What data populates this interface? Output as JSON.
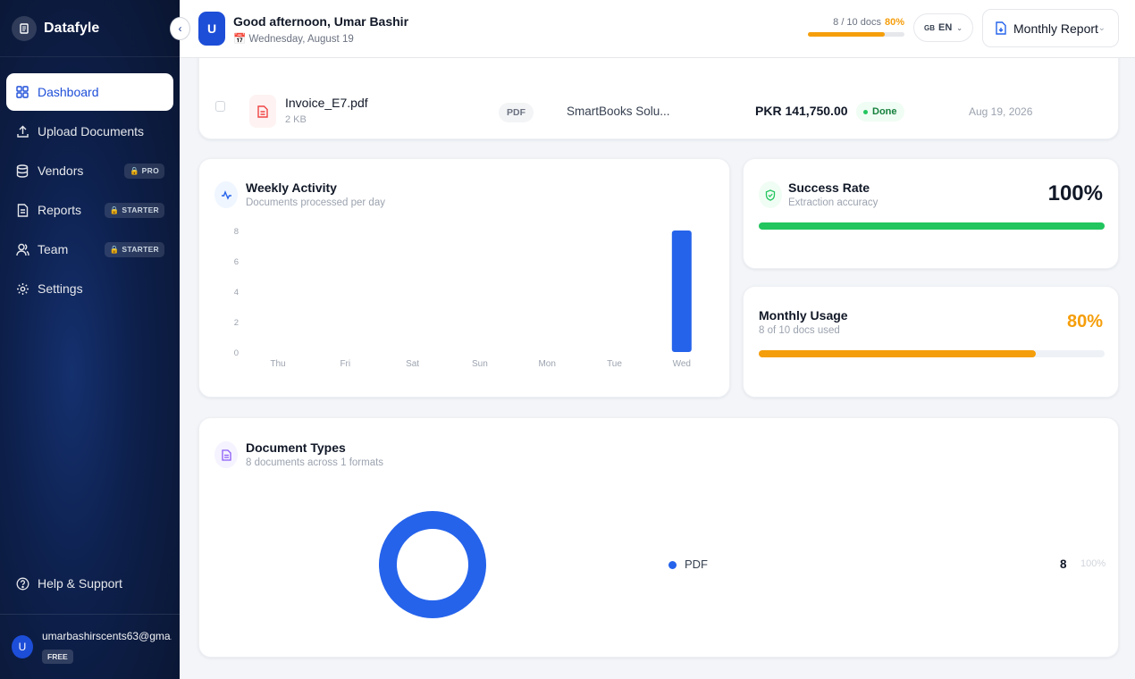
{
  "sidebar": {
    "brand": "Datafyle",
    "items": [
      {
        "label": "Dashboard",
        "icon": "grid-icon",
        "active": true,
        "badge": ""
      },
      {
        "label": "Upload Documents",
        "icon": "upload-icon",
        "badge": ""
      },
      {
        "label": "Vendors",
        "icon": "database-icon",
        "badge": "PRO"
      },
      {
        "label": "Reports",
        "icon": "report-icon",
        "badge": "STARTER"
      },
      {
        "label": "Team",
        "icon": "users-icon",
        "badge": "STARTER"
      },
      {
        "label": "Settings",
        "icon": "gear-icon",
        "badge": ""
      }
    ],
    "help_label": "Help & Support",
    "user": {
      "initial": "U",
      "email": "umarbashirscents63@gma...",
      "plan": "FREE"
    }
  },
  "header": {
    "avatar_initial": "U",
    "greeting": "Good afternoon, Umar Bashir",
    "date": "Wednesday, August 19",
    "usage_text": "8 / 10 docs",
    "usage_pct_text": "80%",
    "usage_fraction": 0.8,
    "lang_flag": "GB",
    "lang_code": "EN",
    "report_label": "Monthly Report"
  },
  "document_row": {
    "name": "Invoice_E7.pdf",
    "size": "2 KB",
    "type": "PDF",
    "vendor": "SmartBooks Solu...",
    "amount": "PKR 141,750.00",
    "status": "Done",
    "date": "Aug 19, 2026"
  },
  "weekly": {
    "title": "Weekly Activity",
    "subtitle": "Documents processed per day"
  },
  "success": {
    "title": "Success Rate",
    "subtitle": "Extraction accuracy",
    "value_text": "100%",
    "fraction": 1.0,
    "color": "#22c55e"
  },
  "monthly": {
    "title": "Monthly Usage",
    "subtitle": "8 of 10 docs used",
    "value_text": "80%",
    "fraction": 0.8,
    "color": "#f59e0b"
  },
  "doc_types": {
    "title": "Document Types",
    "subtitle": "8 documents across 1 formats",
    "legend": [
      {
        "label": "PDF",
        "count": "8",
        "pct": "100%",
        "color": "#2563eb"
      }
    ]
  },
  "chart_data": [
    {
      "type": "bar",
      "categories": [
        "Thu",
        "Fri",
        "Sat",
        "Sun",
        "Mon",
        "Tue",
        "Wed"
      ],
      "values": [
        0,
        0,
        0,
        0,
        0,
        0,
        8
      ],
      "yticks": [
        "0",
        "2",
        "4",
        "6",
        "8"
      ],
      "ylim": [
        0,
        8
      ],
      "color": "#2563eb"
    },
    {
      "type": "pie",
      "categories": [
        "PDF"
      ],
      "values": [
        8
      ],
      "color": "#2563eb"
    }
  ]
}
